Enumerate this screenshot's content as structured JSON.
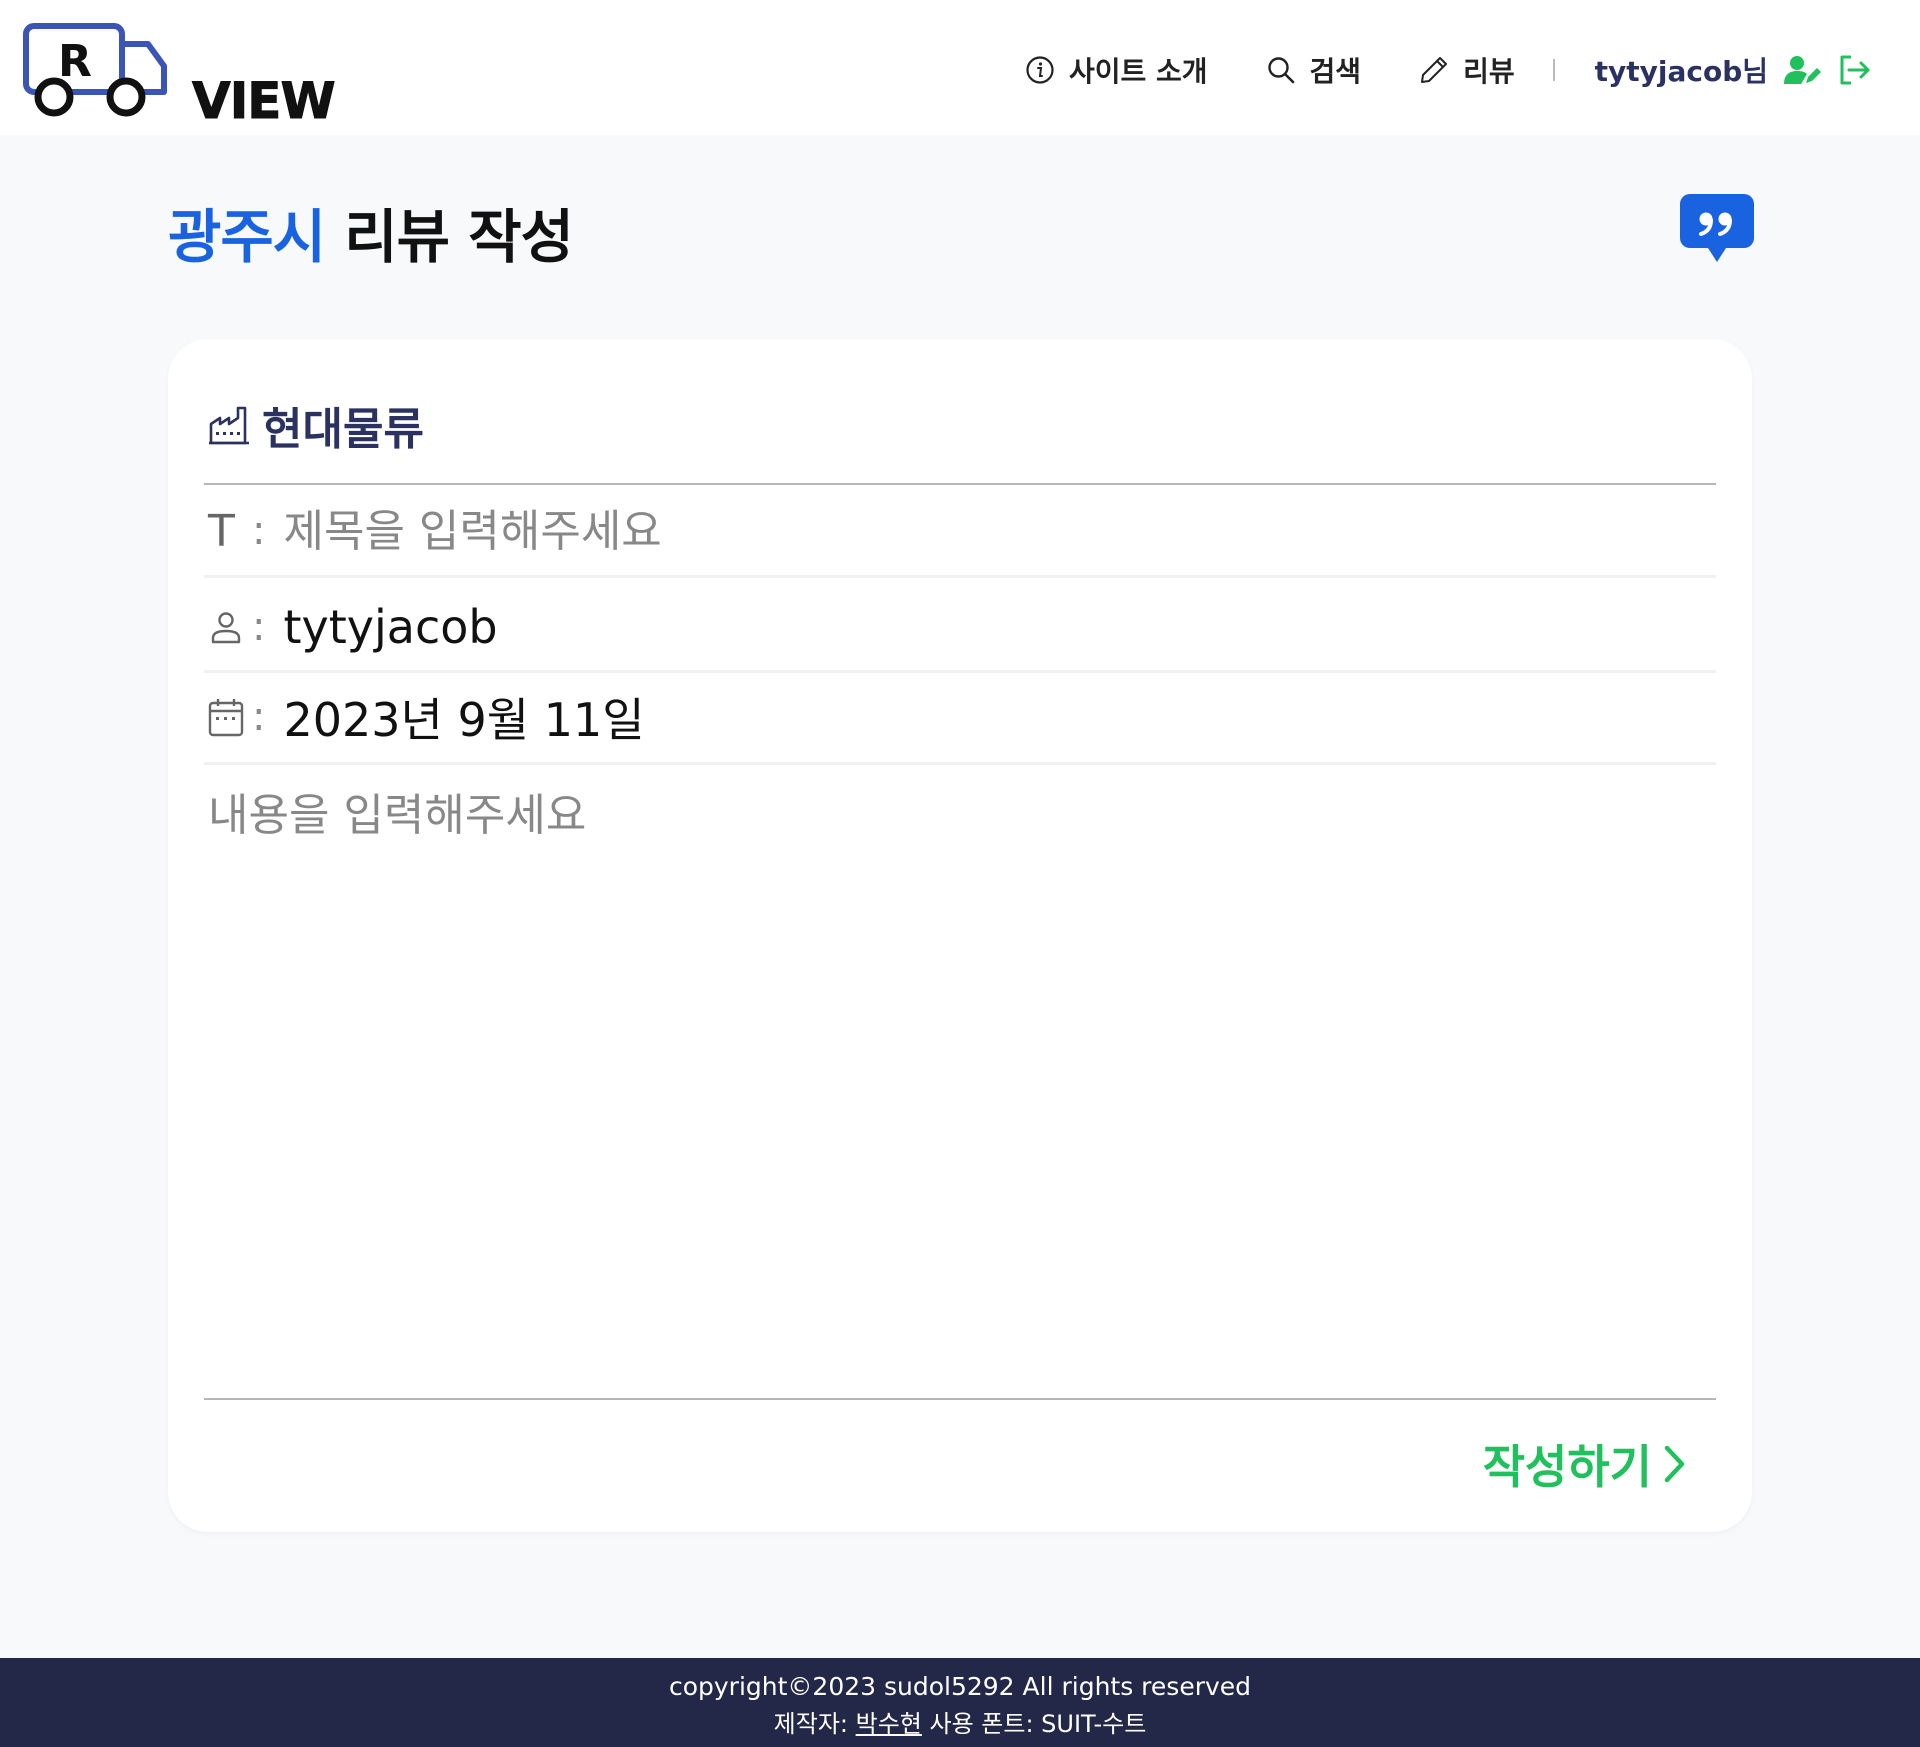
{
  "logo": {
    "letter": "R",
    "text": "VIEW"
  },
  "nav": {
    "about": "사이트 소개",
    "search": "검색",
    "review": "리뷰",
    "user": "tytyjacob님"
  },
  "page": {
    "city": "광주시",
    "title_suffix": "리뷰 작성"
  },
  "form": {
    "company": "현대물류",
    "title_icon": "T",
    "colon": ":",
    "title_placeholder": "제목을 입력해주세요",
    "author": "tytyjacob",
    "date": "2023년 9월 11일",
    "content_placeholder": "내용을 입력해주세요",
    "submit_label": "작성하기"
  },
  "footer": {
    "copyright": "copyright©2023 sudol5292 All rights reserved",
    "maker_label": "제작자:",
    "maker_name": "박수현",
    "font_label": "사용 폰트: SUIT-수트"
  },
  "colors": {
    "accent_blue": "#1a63e0",
    "accent_green": "#20c05c",
    "navy": "#2b3160",
    "footer_bg": "#232848"
  },
  "icons": {
    "about": "info-circle-icon",
    "search": "search-icon",
    "review": "pencil-icon",
    "user_edit": "user-edit-icon",
    "logout": "logout-icon",
    "quote": "quote-bubble-icon",
    "company": "factory-icon",
    "author": "person-icon",
    "date": "calendar-icon",
    "submit": "chevron-right-icon"
  }
}
